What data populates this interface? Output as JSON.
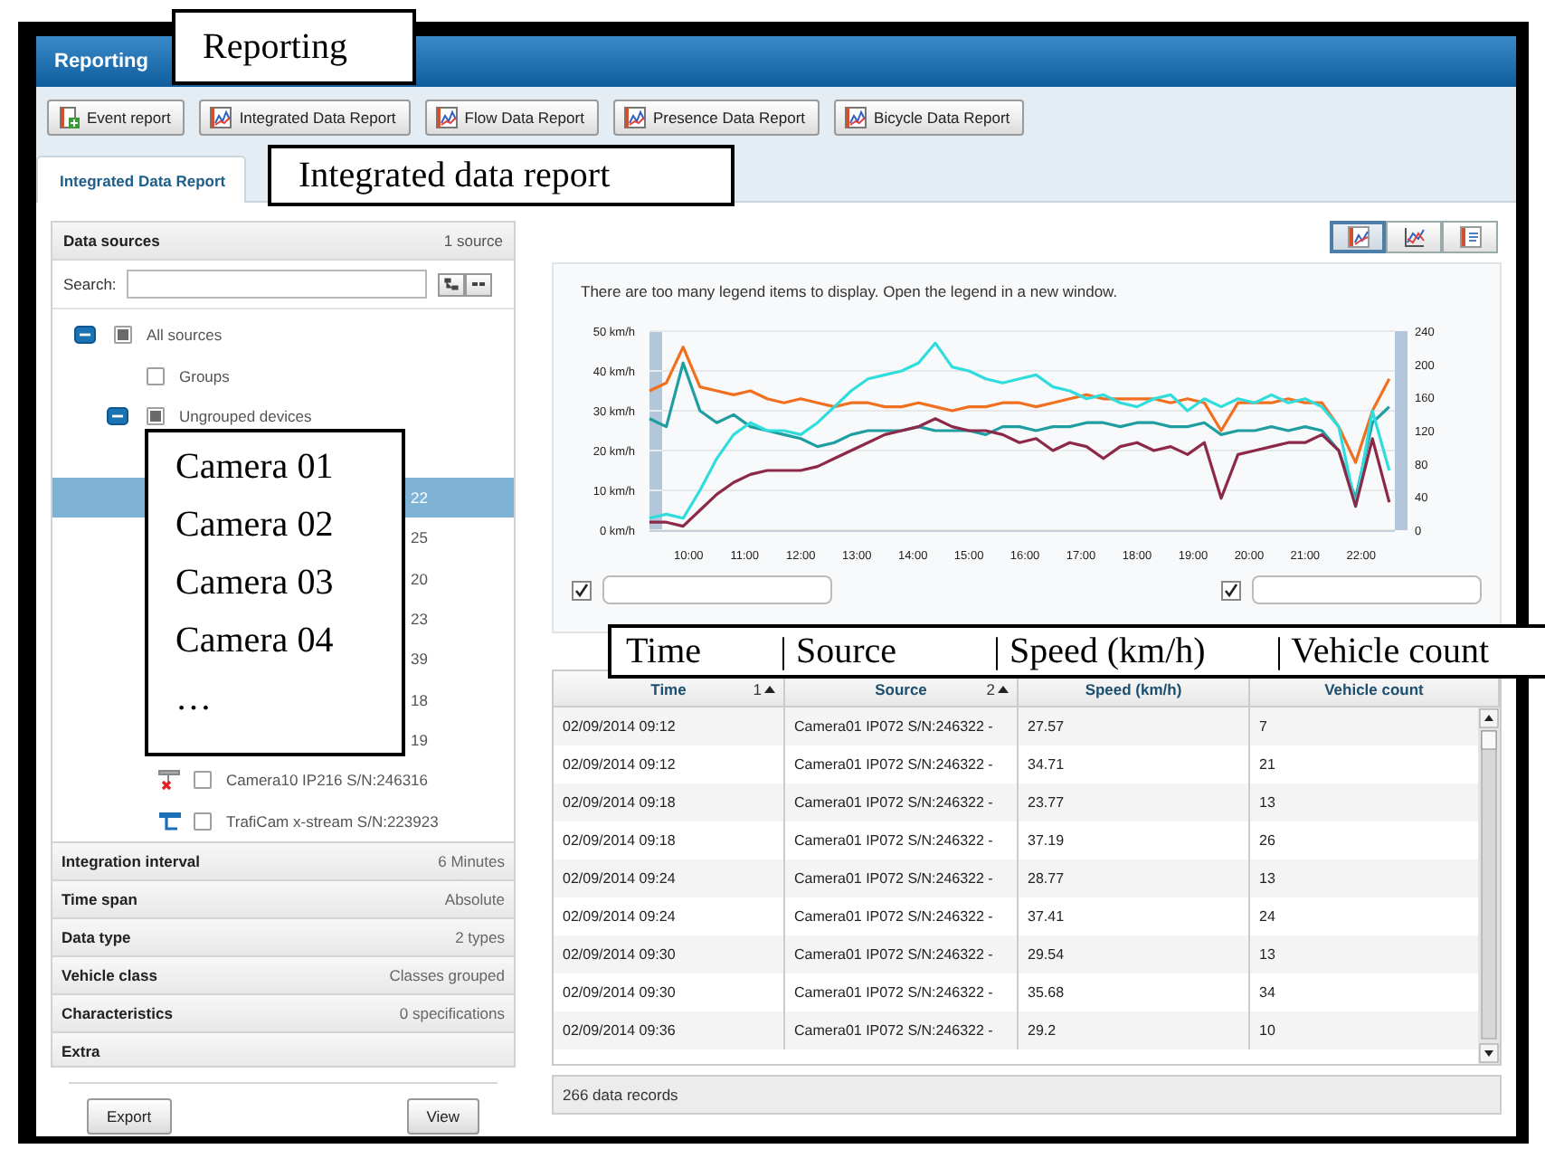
{
  "window": {
    "title": "Reporting"
  },
  "toolbar": [
    {
      "label": "Event report",
      "kind": "event"
    },
    {
      "label": "Integrated Data Report",
      "kind": "chart"
    },
    {
      "label": "Flow Data Report",
      "kind": "chart"
    },
    {
      "label": "Presence Data Report",
      "kind": "chart"
    },
    {
      "label": "Bicycle Data Report",
      "kind": "chart"
    }
  ],
  "tabs": [
    {
      "label": "Integrated Data Report",
      "selected": true
    }
  ],
  "data_sources": {
    "title": "Data sources",
    "count": "1 source",
    "search_label": "Search:",
    "tree": [
      {
        "label": "All sources",
        "kind": "node",
        "expanded": true,
        "partial": true,
        "selected": false,
        "children": [
          {
            "label": "Groups",
            "kind": "node",
            "partial": false,
            "selected": false
          },
          {
            "label": "Ungrouped devices",
            "kind": "node",
            "expanded": true,
            "partial": true,
            "selected": false,
            "children": [
              {
                "label": "22",
                "kind": "fragment",
                "selected": true
              },
              {
                "label": "25",
                "kind": "fragment",
                "selected": false
              },
              {
                "label": "20",
                "kind": "fragment",
                "selected": false
              },
              {
                "label": "23",
                "kind": "fragment",
                "selected": false
              },
              {
                "label": "39",
                "kind": "fragment",
                "selected": false
              },
              {
                "label": "18",
                "kind": "fragment",
                "selected": false
              },
              {
                "label": "19",
                "kind": "fragment",
                "selected": false
              },
              {
                "label": "Camera10 IP216 S/N:246316",
                "kind": "device-offline",
                "checked": false,
                "selected": false
              },
              {
                "label": "TrafiCam x-stream S/N:223923",
                "kind": "device-online",
                "checked": false,
                "selected": false
              }
            ]
          }
        ]
      }
    ]
  },
  "settings": [
    {
      "label": "Integration interval",
      "value": "6 Minutes"
    },
    {
      "label": "Time span",
      "value": "Absolute"
    },
    {
      "label": "Data type",
      "value": "2 types"
    },
    {
      "label": "Vehicle class",
      "value": "Classes grouped"
    },
    {
      "label": "Characteristics",
      "value": "0 specifications"
    },
    {
      "label": "Extra"
    }
  ],
  "actions": [
    "Export",
    "View"
  ],
  "view_modes": [
    {
      "kind": "chart",
      "selected": true
    },
    {
      "kind": "line",
      "selected": false
    },
    {
      "kind": "table",
      "selected": false
    }
  ],
  "chart": {
    "message": "There are too many legend items to display. Open the legend in a new window.",
    "chart_data": {
      "type": "line",
      "x": [
        9.3,
        9.6,
        9.9,
        10.2,
        10.5,
        10.8,
        11.1,
        11.4,
        11.7,
        12,
        12.3,
        12.6,
        12.9,
        13.2,
        13.5,
        13.8,
        14.1,
        14.4,
        14.7,
        15,
        15.3,
        15.6,
        15.9,
        16.2,
        16.5,
        16.8,
        17.1,
        17.4,
        17.7,
        18,
        18.3,
        18.6,
        18.9,
        19.2,
        19.5,
        19.8,
        20.1,
        20.4,
        20.7,
        21,
        21.3,
        21.6,
        21.9,
        22.2,
        22.5
      ],
      "series": [
        {
          "color": "#f07020",
          "values": [
            35,
            37,
            46,
            36,
            35,
            34,
            35,
            33,
            32,
            33,
            32,
            31,
            32,
            32,
            31,
            31,
            32,
            31,
            30,
            31,
            31,
            32,
            32,
            31,
            32,
            33,
            34,
            33,
            33,
            33,
            33,
            32,
            33,
            32,
            25,
            32,
            32,
            32,
            33,
            32,
            32,
            26,
            17,
            30,
            38
          ]
        },
        {
          "color": "#1e9ea0",
          "values": [
            28,
            26,
            42,
            30,
            27,
            29,
            26,
            25,
            24,
            23,
            21,
            22,
            24,
            25,
            25,
            25,
            26,
            25,
            25,
            25,
            24,
            26,
            26,
            25,
            26,
            26,
            27,
            27,
            26,
            27,
            27,
            26,
            26,
            27,
            24,
            25,
            25,
            26,
            25,
            26,
            25,
            20,
            8,
            27,
            31
          ]
        },
        {
          "color": "#30dcdc",
          "values": [
            3,
            4,
            3,
            10,
            18,
            24,
            27,
            25,
            25,
            24,
            27,
            31,
            35,
            38,
            39,
            40,
            42,
            47,
            41,
            40,
            38,
            37,
            38,
            39,
            36,
            35,
            33,
            34,
            32,
            31,
            33,
            34,
            30,
            33,
            31,
            33,
            32,
            34,
            32,
            33,
            31,
            26,
            6,
            30,
            15
          ]
        },
        {
          "color": "#8c2848",
          "values": [
            2,
            2,
            1,
            5,
            9,
            12,
            14,
            15,
            15,
            15,
            16,
            18,
            20,
            22,
            24,
            25,
            26,
            28,
            26,
            25,
            25,
            24,
            22,
            23,
            20,
            22,
            21,
            18,
            21,
            22,
            20,
            21,
            19,
            22,
            8,
            19,
            20,
            21,
            22,
            22,
            24,
            20,
            6,
            23,
            7
          ]
        }
      ],
      "xlim": [
        9.3,
        22.6
      ],
      "ylim": [
        0,
        50
      ],
      "grid": true,
      "xticks": [
        {
          "value": 10,
          "label": "10:00"
        },
        {
          "value": 11,
          "label": "11:00"
        },
        {
          "value": 12,
          "label": "12:00"
        },
        {
          "value": 13,
          "label": "13:00"
        },
        {
          "value": 14,
          "label": "14:00"
        },
        {
          "value": 15,
          "label": "15:00"
        },
        {
          "value": 16,
          "label": "16:00"
        },
        {
          "value": 17,
          "label": "17:00"
        },
        {
          "value": 18,
          "label": "18:00"
        },
        {
          "value": 19,
          "label": "19:00"
        },
        {
          "value": 20,
          "label": "20:00"
        },
        {
          "value": 21,
          "label": "21:00"
        },
        {
          "value": 22,
          "label": "22:00"
        }
      ],
      "yticks": [
        {
          "value": 0,
          "label": "0 km/h"
        },
        {
          "value": 10,
          "label": "10 km/h"
        },
        {
          "value": 20,
          "label": "20 km/h"
        },
        {
          "value": 30,
          "label": "30 km/h"
        },
        {
          "value": 40,
          "label": "40 km/h"
        },
        {
          "value": 50,
          "label": "50 km/h"
        }
      ],
      "y2lim": [
        0,
        240
      ],
      "y2ticks": [
        0,
        40,
        80,
        120,
        160,
        200,
        240
      ]
    },
    "controls": [
      {
        "checked": true
      },
      {
        "checked": true
      }
    ]
  },
  "table": {
    "columns": [
      {
        "label": "Time",
        "sort": "1"
      },
      {
        "label": "Source",
        "sort": "2"
      },
      {
        "label": "Speed (km/h)"
      },
      {
        "label": "Vehicle count"
      }
    ],
    "rows": [
      [
        "02/09/2014 09:12",
        "Camera01 IP072 S/N:246322 -",
        "27.57",
        "7"
      ],
      [
        "02/09/2014 09:12",
        "Camera01 IP072 S/N:246322 -",
        "34.71",
        "21"
      ],
      [
        "02/09/2014 09:18",
        "Camera01 IP072 S/N:246322 -",
        "23.77",
        "13"
      ],
      [
        "02/09/2014 09:18",
        "Camera01 IP072 S/N:246322 -",
        "37.19",
        "26"
      ],
      [
        "02/09/2014 09:24",
        "Camera01 IP072 S/N:246322 -",
        "28.77",
        "13"
      ],
      [
        "02/09/2014 09:24",
        "Camera01 IP072 S/N:246322 -",
        "37.41",
        "24"
      ],
      [
        "02/09/2014 09:30",
        "Camera01 IP072 S/N:246322 -",
        "29.54",
        "13"
      ],
      [
        "02/09/2014 09:30",
        "Camera01 IP072 S/N:246322 -",
        "35.68",
        "34"
      ],
      [
        "02/09/2014 09:36",
        "Camera01 IP072 S/N:246322 -",
        "29.2",
        "10"
      ]
    ],
    "footer": "266 data records"
  },
  "annotations": [
    {
      "kind": "text",
      "items": [
        "Reporting"
      ]
    },
    {
      "kind": "text",
      "items": [
        "Integrated data report"
      ]
    },
    {
      "kind": "text",
      "items": [
        "Camera 01",
        "Camera 02",
        "Camera 03",
        "Camera 04",
        "…"
      ]
    },
    {
      "kind": "columns",
      "items": [
        "Time",
        "| Source",
        "| Speed (km/h)",
        "| Vehicle count"
      ]
    }
  ]
}
